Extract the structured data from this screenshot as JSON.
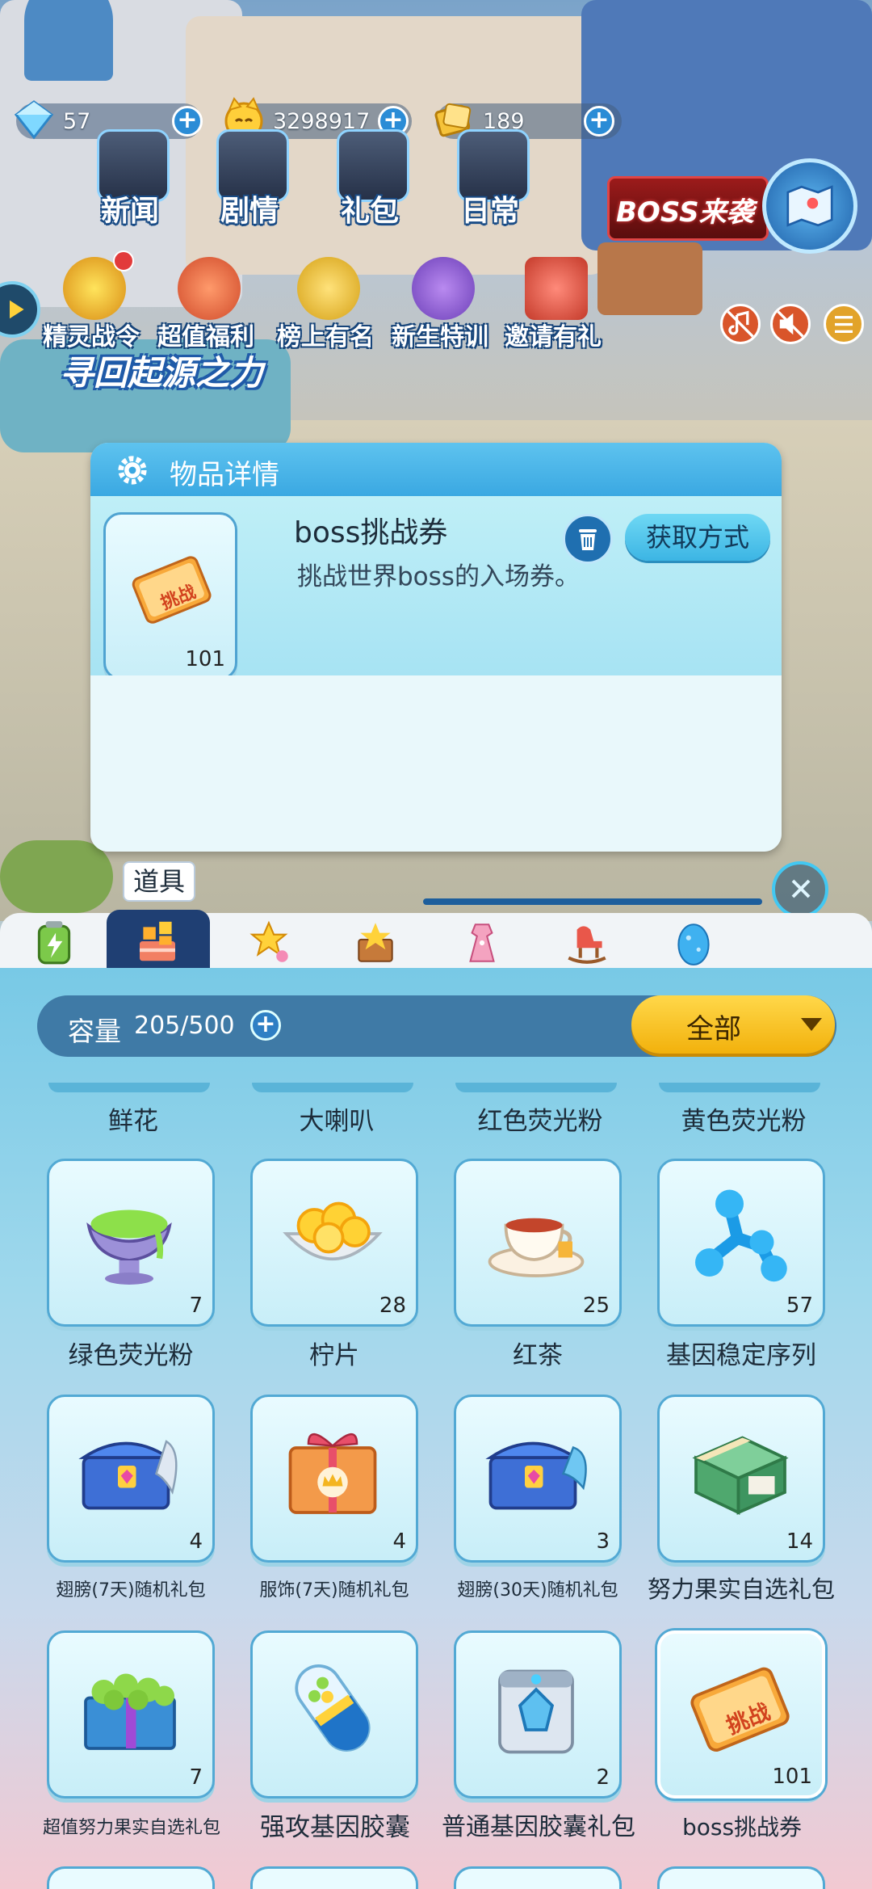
{
  "currencies": [
    {
      "icon": "diamond-icon",
      "value": "57"
    },
    {
      "icon": "cat-coin-icon",
      "value": "3298917"
    },
    {
      "icon": "gold-ticket-icon",
      "value": "189"
    }
  ],
  "top_nav": [
    {
      "label": "新闻",
      "icon": "news-icon"
    },
    {
      "label": "剧情",
      "icon": "story-icon"
    },
    {
      "label": "礼包",
      "icon": "gift-pack-icon"
    },
    {
      "label": "日常",
      "icon": "daily-icon"
    }
  ],
  "boss_banner": "BOSS来袭",
  "events": [
    {
      "label": "精灵战令",
      "icon": "battle-pass-icon"
    },
    {
      "label": "超值福利",
      "icon": "gift-box-icon"
    },
    {
      "label": "榜上有名",
      "icon": "trophy-icon"
    },
    {
      "label": "新生特训",
      "icon": "star-badge-icon"
    },
    {
      "label": "邀请有礼",
      "icon": "invite-letter-icon"
    }
  ],
  "event_banner": "寻回起源之力",
  "dialog": {
    "title": "物品详情",
    "item_name": "boss挑战券",
    "item_desc": "挑战世界boss的入场券。",
    "item_count": "101",
    "item_art_text": "挑战",
    "get_button": "获取方式"
  },
  "category_label": "道具",
  "inventory": {
    "capacity_label": "容量",
    "capacity_value": "205/500",
    "filter": "全部",
    "partial_row": [
      "鲜花",
      "大喇叭",
      "红色荧光粉",
      "黄色荧光粉"
    ],
    "items": [
      {
        "name": "绿色荧光粉",
        "count": "7",
        "icon": "green-powder-icon"
      },
      {
        "name": "柠片",
        "count": "28",
        "icon": "lemon-slice-icon"
      },
      {
        "name": "红茶",
        "count": "25",
        "icon": "black-tea-icon"
      },
      {
        "name": "基因稳定序列",
        "count": "57",
        "icon": "gene-molecule-icon"
      },
      {
        "name": "翅膀(7天)随机礼包",
        "count": "4",
        "icon": "wing-chest-icon"
      },
      {
        "name": "服饰(7天)随机礼包",
        "count": "4",
        "icon": "clothing-box-icon"
      },
      {
        "name": "翅膀(30天)随机礼包",
        "count": "3",
        "icon": "wing-chest-icon"
      },
      {
        "name": "努力果实自选礼包",
        "count": "14",
        "icon": "green-gift-icon"
      },
      {
        "name": "超值努力果实自选礼包",
        "count": "7",
        "icon": "fruit-box-icon"
      },
      {
        "name": "强攻基因胶囊",
        "count": "",
        "icon": "gene-capsule-icon"
      },
      {
        "name": "普通基因胶囊礼包",
        "count": "2",
        "icon": "capsule-case-icon"
      },
      {
        "name": "boss挑战券",
        "count": "101",
        "icon": "boss-ticket-icon",
        "ticket_text": "挑战"
      }
    ]
  },
  "colors": {
    "accent": "#3aa8e2",
    "filter_button": "#f7c21c",
    "panel_bar": "#3f7aa6"
  }
}
